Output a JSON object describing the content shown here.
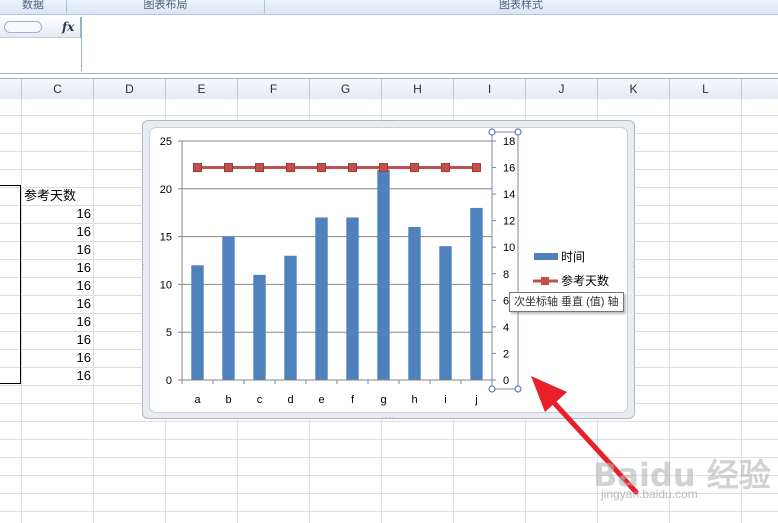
{
  "ribbon": {
    "groups": [
      {
        "label": "数据"
      },
      {
        "label": "图表布局"
      },
      {
        "label": "图表样式"
      }
    ]
  },
  "formula_bar": {
    "fx_label": "fx",
    "value": ""
  },
  "columns": [
    "C",
    "D",
    "E",
    "F",
    "G",
    "H",
    "I",
    "J",
    "K",
    "L"
  ],
  "sheet": {
    "header_cell": "参考天数",
    "values": [
      "16",
      "16",
      "16",
      "16",
      "16",
      "16",
      "16",
      "16",
      "16",
      "16"
    ]
  },
  "chart_data": {
    "type": "bar",
    "categories": [
      "a",
      "b",
      "c",
      "d",
      "e",
      "f",
      "g",
      "h",
      "i",
      "j"
    ],
    "series": [
      {
        "name": "时间",
        "type": "bar",
        "axis": "primary",
        "color": "#4f81bd",
        "values": [
          12,
          15,
          11,
          13,
          17,
          17,
          22,
          16,
          14,
          18
        ]
      },
      {
        "name": "参考天数",
        "type": "line",
        "axis": "secondary",
        "color": "#c0504d",
        "marker": "square",
        "values": [
          16,
          16,
          16,
          16,
          16,
          16,
          16,
          16,
          16,
          16
        ]
      }
    ],
    "y_primary": {
      "min": 0,
      "max": 25,
      "ticks": [
        "0",
        "5",
        "10",
        "15",
        "20",
        "25"
      ]
    },
    "y_secondary": {
      "min": 0,
      "max": 18,
      "ticks": [
        "0",
        "2",
        "4",
        "6",
        "8",
        "10",
        "12",
        "14",
        "16",
        "18"
      ]
    },
    "grid": true,
    "legend": "right"
  },
  "tooltip": "次坐标轴 垂直 (值) 轴",
  "watermark": {
    "logo": "Baidu 经验",
    "url": "jingyan.baidu.com"
  },
  "colors": {
    "bar": "#4f81bd",
    "line": "#c0504d",
    "arrow": "#e8202a"
  }
}
